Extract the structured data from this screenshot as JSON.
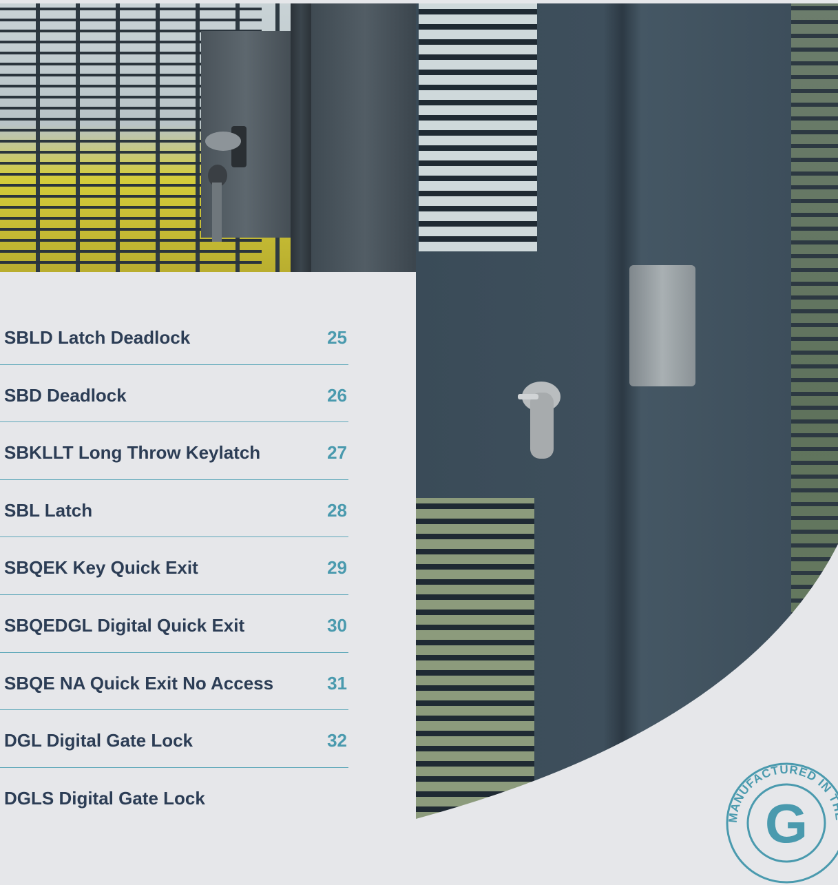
{
  "toc": {
    "items": [
      {
        "title": "SBLD Latch Deadlock",
        "page": "25"
      },
      {
        "title": "SBD Deadlock",
        "page": "26"
      },
      {
        "title": "SBKLLT Long Throw Keylatch",
        "page": "27"
      },
      {
        "title": "SBL Latch",
        "page": "28"
      },
      {
        "title": "SBQEK Key Quick Exit",
        "page": "29"
      },
      {
        "title": "SBQEDGL Digital Quick Exit",
        "page": "30"
      },
      {
        "title": "SBQE NA Quick Exit No Access",
        "page": "31"
      },
      {
        "title": "DGL Digital Gate Lock",
        "page": "32"
      },
      {
        "title": "DGLS Digital Gate Lock",
        "page": ""
      }
    ]
  },
  "badge": {
    "text": "MANUFACTURED IN THE UK",
    "letter": "G"
  },
  "colors": {
    "background": "#e6e7ea",
    "title_text": "#2c3d55",
    "page_number": "#4a9aae",
    "divider": "#5aa6b8",
    "gate_frame": "#3d4e5b"
  }
}
